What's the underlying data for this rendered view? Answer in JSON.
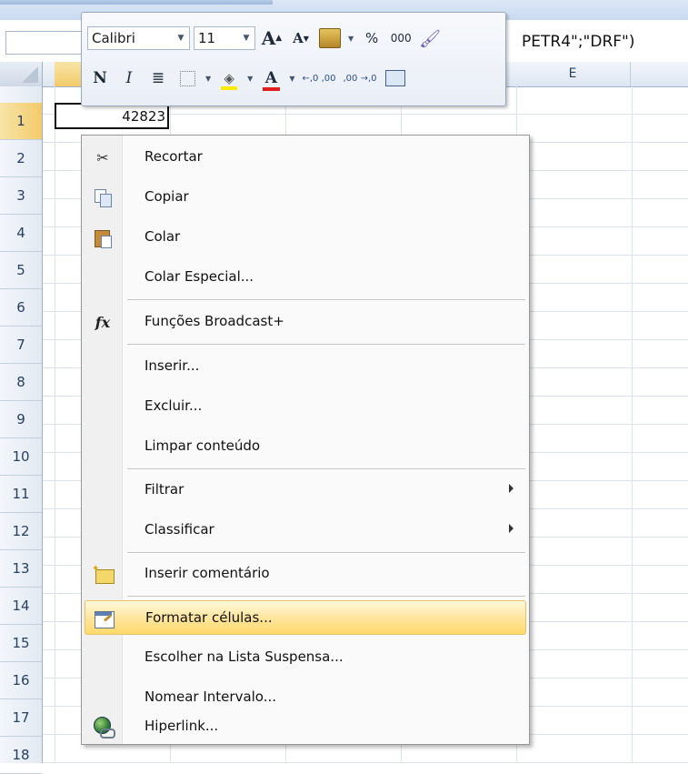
{
  "formula_bar": {
    "text": "PETR4\";\"DRF\")"
  },
  "columns": [
    "E"
  ],
  "rows": [
    "1",
    "2",
    "3",
    "4",
    "5",
    "6",
    "7",
    "8",
    "9",
    "10",
    "11",
    "12",
    "13",
    "14",
    "15",
    "16",
    "17",
    "18"
  ],
  "active_cell": {
    "value": "42823"
  },
  "mini_toolbar": {
    "font_name": "Calibri",
    "font_size": "11",
    "grow_font": "A",
    "shrink_font": "A",
    "percent": "%",
    "thousands": "000",
    "bold": "N",
    "italic": "I",
    "font_color": "A",
    "inc_decimal": "←,0 ,00",
    "dec_decimal": ",00 →,0"
  },
  "context_menu": {
    "items": [
      {
        "label": "Recortar",
        "icon": "scissors-icon"
      },
      {
        "label": "Copiar",
        "icon": "copy-icon"
      },
      {
        "label": "Colar",
        "icon": "paste-icon"
      },
      {
        "label": "Colar Especial...",
        "icon": ""
      },
      {
        "label": "Funções Broadcast+",
        "icon": "function-icon"
      },
      {
        "label": "Inserir...",
        "icon": ""
      },
      {
        "label": "Excluir...",
        "icon": ""
      },
      {
        "label": "Limpar conteúdo",
        "icon": ""
      },
      {
        "label": "Filtrar",
        "icon": "",
        "submenu": true
      },
      {
        "label": "Classificar",
        "icon": "",
        "submenu": true
      },
      {
        "label": "Inserir comentário",
        "icon": "comment-icon"
      },
      {
        "label": "Formatar células...",
        "icon": "format-cells-icon",
        "highlighted": true
      },
      {
        "label": "Escolher na Lista Suspensa...",
        "icon": ""
      },
      {
        "label": "Nomear Intervalo...",
        "icon": ""
      },
      {
        "label": "Hiperlink...",
        "icon": "hyperlink-icon"
      }
    ]
  },
  "colors": {
    "highlight": "#ffe59a",
    "font_color_bar": "#e21d1d",
    "fill_color_bar": "#ffeb00"
  }
}
